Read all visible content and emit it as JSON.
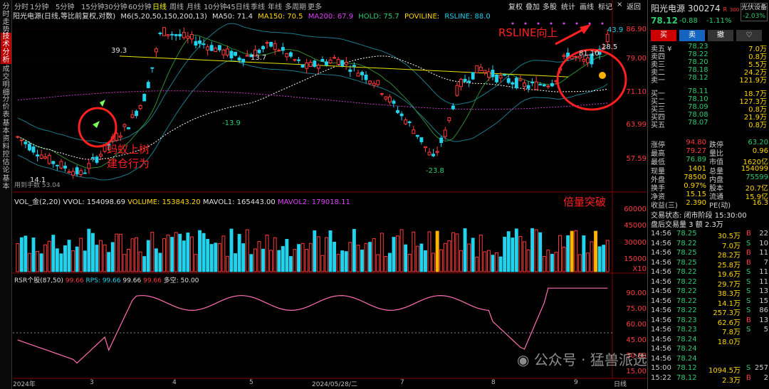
{
  "side_tabs": [
    {
      "label": "分时走势",
      "active": false
    },
    {
      "label": "技术分析",
      "active": true
    },
    {
      "label": "成交明细",
      "active": false
    },
    {
      "label": "分价表",
      "active": false
    },
    {
      "label": "基本资料",
      "active": false
    },
    {
      "label": "控估论",
      "active": false
    },
    {
      "label": "基本",
      "active": false
    }
  ],
  "period_tabs": [
    "分时",
    "1分钟",
    "5分钟",
    "15分钟",
    "30分钟",
    "60分钟",
    "日线",
    "周线",
    "月线",
    "10分钟",
    "45日线",
    "季线",
    "年线",
    "多周期",
    "更多"
  ],
  "active_period": "日线",
  "toolbar_right": [
    "复权",
    "叠加",
    "多股",
    "统计",
    "画线",
    "标记"
  ],
  "window_icons": {
    "close": "×",
    "back": "返回"
  },
  "main_indicator": {
    "title": "阳光电源(日线,等比前复权,对数)",
    "ma_label": "M6(5,20,50,150,200,13)",
    "ma50": "MA50: 71.4",
    "ma150": "MA150: 70.5",
    "ma200": "MA200: 67.9",
    "hold": "HOLD: 75.7",
    "poviline": "POVILINE:",
    "rsline": "RSLINE: 88.0"
  },
  "price_axis": [
    "86.90",
    "79.00",
    "71.10",
    "63.99",
    "57.59"
  ],
  "price_annotations": [
    "39.3",
    "13.7",
    "-13.9",
    "-23.8",
    "81.10",
    "28.5",
    "43.9",
    "14.1"
  ],
  "low_label": "用到手数 53.04",
  "annotation_rsline": "RSLINE向上",
  "annotation_ant": "蚂蚁上树\n建仓行为",
  "annotation_volume": "倍量突破",
  "vol_indicator": {
    "label": "VOL_金(2,20)",
    "vvol": "VVOL: 154098.69",
    "volume": "VOLUME: 153843.20",
    "mavol1": "MAVOL1: 165443.00",
    "mavol2": "MAVOL2: 179018.11"
  },
  "vol_axis": [
    "60000",
    "45000",
    "30000",
    "15000",
    "X10"
  ],
  "rsr_indicator": {
    "label": "RSR个股(87,50)",
    "v1": "99.66",
    "rps": "RPS: 99.66",
    "v3": "99.66",
    "v4": "99.66",
    "more": "多空: 50.00"
  },
  "rsr_axis": [
    "90.00",
    "75.00",
    "60.00",
    "45.00",
    "30.00",
    "15.00"
  ],
  "date_axis": [
    "2024年",
    "3",
    "4",
    "5",
    "2024/05/28/二",
    "7",
    "8",
    "9"
  ],
  "date_tail": "日线",
  "watermark": "公众号 · 猛兽派选股",
  "quote": {
    "name": "阳光电源",
    "code": "300274",
    "tag": "R",
    "tag2": "300",
    "sector": "光伏设备",
    "sector_change": "-2.03%",
    "price": "78.12",
    "change": "-0.88",
    "pct": "-1.11%",
    "buttons": [
      "买",
      "卖",
      "撤",
      "♡"
    ],
    "asks": [
      {
        "label": "卖五 ¥",
        "price": "78.23",
        "vol": "7.0万"
      },
      {
        "label": "卖四",
        "price": "78.22",
        "vol": "0.8万"
      },
      {
        "label": "卖三",
        "price": "78.20",
        "vol": "5.5万"
      },
      {
        "label": "卖二",
        "price": "78.18",
        "vol": "24.2万"
      },
      {
        "label": "卖一",
        "price": "78.12",
        "vol": "121.9万"
      }
    ],
    "bids": [
      {
        "label": "买一",
        "price": "78.11",
        "vol": "18.7万"
      },
      {
        "label": "买二",
        "price": "78.10",
        "vol": "127.3万"
      },
      {
        "label": "买三",
        "price": "78.09",
        "vol": "0.8万"
      },
      {
        "label": "买四",
        "price": "78.08",
        "vol": "21.9万"
      },
      {
        "label": "买五",
        "price": "78.07",
        "vol": "0.8万"
      }
    ],
    "stats": [
      {
        "l1": "涨停",
        "v1": "94.80",
        "l2": "跌停",
        "v2": "63.20"
      },
      {
        "l1": "最高",
        "v1": "79.27",
        "l2": "量比",
        "v2": "0.96"
      },
      {
        "l1": "最低",
        "v1": "76.89",
        "l2": "市值",
        "v2": "1620亿"
      },
      {
        "l1": "现量",
        "v1": "1401",
        "l2": "总量",
        "v2": "154099"
      },
      {
        "l1": "外盘",
        "v1": "78500",
        "l2": "内盘",
        "v2": "75599"
      },
      {
        "l1": "换手",
        "v1": "0.97%",
        "l2": "股本",
        "v2": "20.7亿"
      },
      {
        "l1": "净资",
        "v1": "15.15",
        "l2": "流通",
        "v2": "15.9亿"
      },
      {
        "l1": "收益(三)",
        "v1": "2.390",
        "l2": "PE(动)",
        "v2": "16.3"
      }
    ],
    "trade_status": "交易状态: 闭市阶段 15:30:00",
    "after_hours": "盘后交易量 3 额 2.3万",
    "ticks": [
      {
        "t": "14:56",
        "p": "78.25",
        "v": "30.5万",
        "d": "B",
        "n": "22"
      },
      {
        "t": "14:56",
        "p": "78.22",
        "v": "7.0万",
        "d": "S",
        "n": "10"
      },
      {
        "t": "14:56",
        "p": "78.25",
        "v": "28.2万",
        "d": "B",
        "n": "11"
      },
      {
        "t": "14:56",
        "p": "78.25",
        "v": "25.8万",
        "d": "B",
        "n": "7"
      },
      {
        "t": "14:56",
        "p": "78.22",
        "v": "19.6万",
        "d": "S",
        "n": "11"
      },
      {
        "t": "14:56",
        "p": "78.22",
        "v": "29.7万",
        "d": "S",
        "n": "11"
      },
      {
        "t": "14:56",
        "p": "78.22",
        "v": "38.3万",
        "d": "S",
        "n": "13"
      },
      {
        "t": "14:56",
        "p": "78.22",
        "v": "14.1万",
        "d": "S",
        "n": "15"
      },
      {
        "t": "14:56",
        "p": "78.22",
        "v": "257.3万",
        "d": "S",
        "n": "86"
      },
      {
        "t": "14:56",
        "p": "78.23",
        "v": "62.6万",
        "d": "B",
        "n": "13"
      },
      {
        "t": "14:56",
        "p": "78.23",
        "v": "7.8万",
        "d": "S",
        "n": "5"
      },
      {
        "t": "14:56",
        "p": "78.24",
        "v": "18.0万",
        "d": "",
        "n": ""
      },
      {
        "t": "14:56",
        "p": "78.24",
        "v": "",
        "d": "",
        "n": ""
      },
      {
        "t": "14:56",
        "p": "78.24",
        "v": "",
        "d": "",
        "n": ""
      },
      {
        "t": "15:00",
        "p": "78.12",
        "v": "1094.5万",
        "d": "S",
        "n": "257"
      },
      {
        "t": "15:22",
        "p": "78.12",
        "v": "2.3万",
        "d": "B",
        "n": "2"
      }
    ]
  }
}
